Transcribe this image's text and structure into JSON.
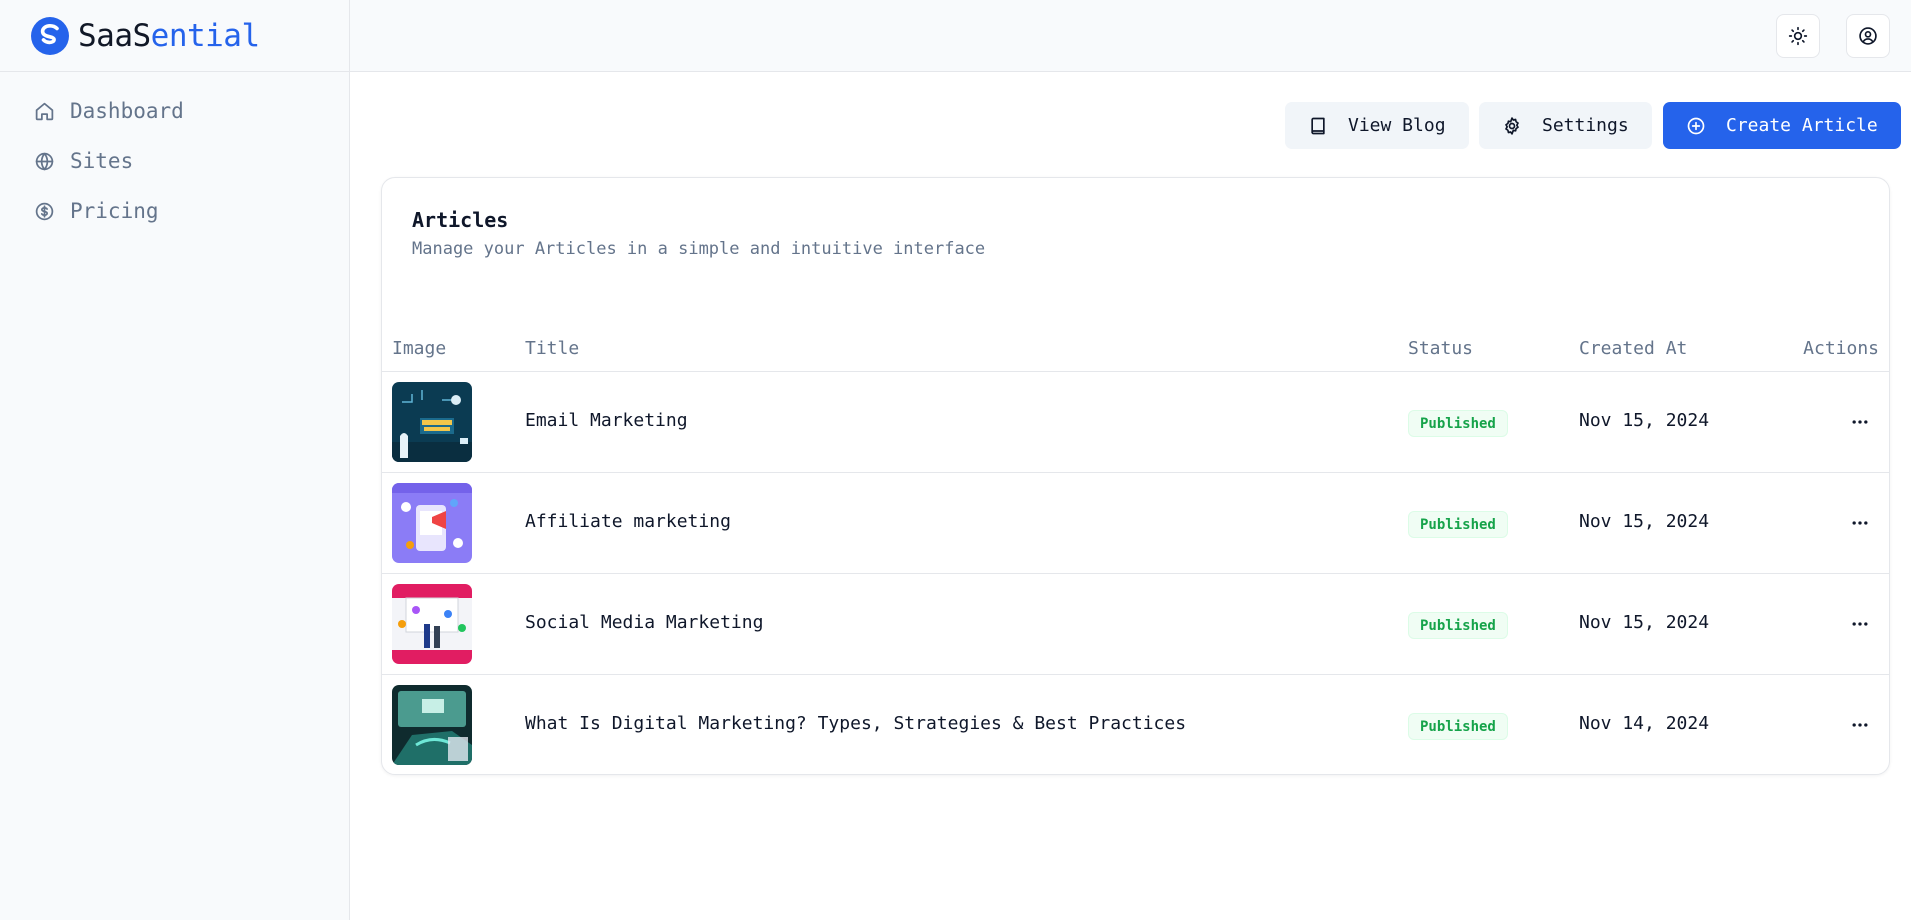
{
  "brand": {
    "name_part1": "SaaS",
    "name_part2": "ential",
    "primary_color": "#2563eb"
  },
  "sidebar": {
    "items": [
      {
        "label": "Dashboard",
        "icon": "home-icon"
      },
      {
        "label": "Sites",
        "icon": "globe-icon"
      },
      {
        "label": "Pricing",
        "icon": "dollar-circle-icon"
      }
    ]
  },
  "header": {
    "theme_toggle_icon": "sun-icon",
    "profile_icon": "user-circle-icon"
  },
  "toolbar": {
    "view_blog_label": "View Blog",
    "settings_label": "Settings",
    "create_article_label": "Create Article"
  },
  "card": {
    "title": "Articles",
    "description": "Manage your Articles in a simple and intuitive interface"
  },
  "table": {
    "columns": [
      "Image",
      "Title",
      "Status",
      "Created At",
      "Actions"
    ],
    "rows": [
      {
        "title": "Email Marketing",
        "status": "Published",
        "created_at": "Nov 15, 2024"
      },
      {
        "title": "Affiliate marketing",
        "status": "Published",
        "created_at": "Nov 15, 2024"
      },
      {
        "title": "Social Media Marketing",
        "status": "Published",
        "created_at": "Nov 15, 2024"
      },
      {
        "title": "What Is Digital Marketing? Types, Strategies & Best Practices",
        "status": "Published",
        "created_at": "Nov 14, 2024"
      }
    ]
  },
  "status_colors": {
    "published_text": "#16a34a",
    "published_bg": "#f0fdf4"
  }
}
